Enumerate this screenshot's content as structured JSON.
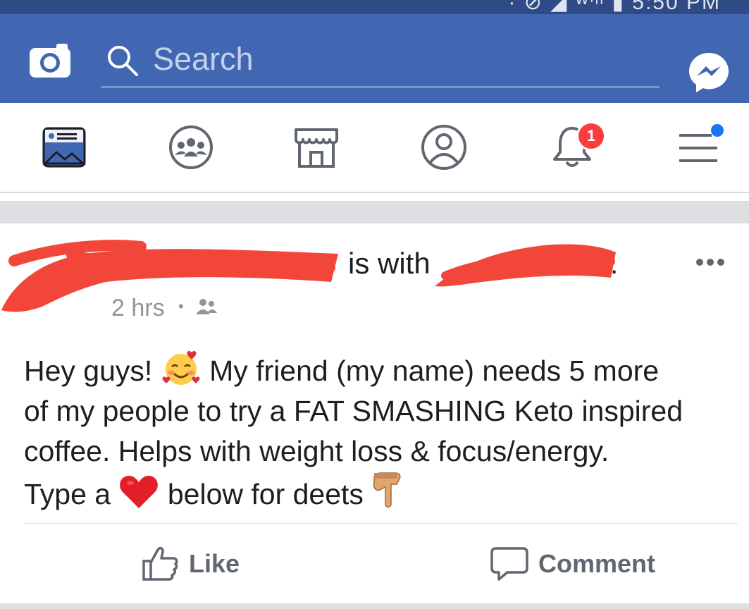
{
  "status_bar": {
    "text": "· ⊘ ◢ ᵂⁱˡˡ ▮ 5:50 PM"
  },
  "header": {
    "search_placeholder": "Search"
  },
  "nav": {
    "items": [
      {
        "name": "news-feed"
      },
      {
        "name": "groups"
      },
      {
        "name": "marketplace"
      },
      {
        "name": "profile"
      },
      {
        "name": "notifications"
      },
      {
        "name": "menu"
      }
    ],
    "notification_count": "1"
  },
  "post": {
    "author_suffix": "is with",
    "tag_trailing": ".",
    "timestamp": "2 hrs",
    "separator": "•",
    "text_line1a": "Hey guys! ",
    "text_line1b": " My friend (my name) needs 5 more",
    "text_line2": "of my people to try a FAT SMASHING Keto inspired",
    "text_line3": "coffee. Helps with weight loss & focus/energy.",
    "text_line4a": "Type a ",
    "text_line4b": " below for deets ",
    "actions": {
      "like": "Like",
      "comment": "Comment"
    }
  },
  "colors": {
    "brand": "#4267b2",
    "redaction": "#f2463a",
    "notification_badge": "#fa3e3e",
    "icon_gray": "#606770"
  }
}
